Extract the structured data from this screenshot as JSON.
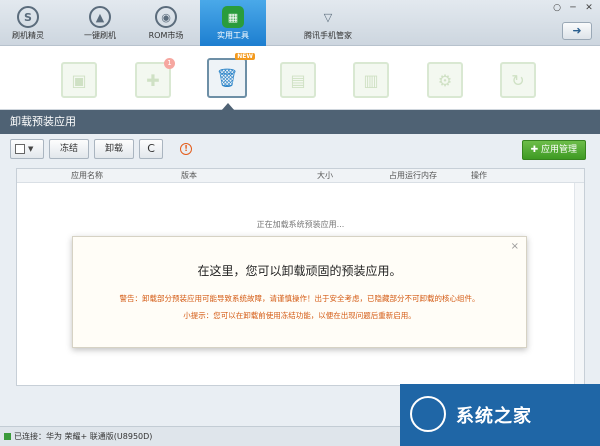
{
  "nav": {
    "items": [
      {
        "label": "刷机精灵",
        "icon": "brush-wizard-icon",
        "glyph": "S"
      },
      {
        "label": "一键刷机",
        "icon": "one-key-flash-icon",
        "glyph": "▲"
      },
      {
        "label": "ROM市场",
        "icon": "rom-market-icon",
        "glyph": "◉"
      },
      {
        "label": "实用工具",
        "icon": "tools-grid-icon",
        "glyph": "▦"
      },
      {
        "label": "腾讯手机管家",
        "icon": "tencent-shield-icon",
        "glyph": "▽"
      }
    ],
    "active_index": 3,
    "window_controls": [
      "○",
      "─",
      "✕"
    ],
    "sync_glyph": "➜"
  },
  "tools": [
    {
      "name": "market-bag-icon",
      "glyph": "▣"
    },
    {
      "name": "plugin-puzzle-icon",
      "glyph": "✚",
      "badge": "1"
    },
    {
      "name": "uninstall-trash-icon",
      "glyph": "🗑",
      "badge": "NEW",
      "active": true
    },
    {
      "name": "document-copy-icon",
      "glyph": "▤"
    },
    {
      "name": "export-doc-icon",
      "glyph": "▥"
    },
    {
      "name": "settings-doc-icon",
      "glyph": "⚙"
    },
    {
      "name": "refresh-doc-icon",
      "glyph": "↻"
    }
  ],
  "section": {
    "title": "卸载预装应用"
  },
  "toolbar": {
    "freeze_label": "冻结",
    "uninstall_label": "卸载",
    "refresh_glyph": "C",
    "warn_glyph": "!",
    "app_manage_label": "应用管理",
    "app_manage_glyph": "✚"
  },
  "table": {
    "columns": [
      "应用名称",
      "版本",
      "大小",
      "占用运行内存",
      "操作"
    ],
    "loading_text": "正在加载系统预装应用..."
  },
  "dialog": {
    "title": "在这里，您可以卸载顽固的预装应用。",
    "warning": "警告：卸载部分预装应用可能导致系统故障，请谨慎操作！出于安全考虑，已隐藏部分不可卸载的核心组件。",
    "tip": "小提示：您可以在卸载前使用冻结功能，以便在出现问题后重新启用。",
    "close_glyph": "×"
  },
  "status": {
    "text": "已连接：华为 荣耀+ 联通版(U8950D)"
  },
  "watermark": {
    "text": "系统之家"
  },
  "colors": {
    "accent": "#1d7ed0",
    "section_bar": "#4f6274",
    "warning_text": "#d45b14",
    "green_button": "#3e9a23"
  }
}
